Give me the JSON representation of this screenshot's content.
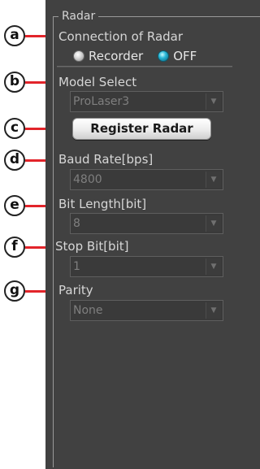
{
  "group": {
    "title": "Radar"
  },
  "connection": {
    "label": "Connection of Radar",
    "options": [
      {
        "label": "Recorder",
        "selected": false
      },
      {
        "label": "OFF",
        "selected": true
      }
    ]
  },
  "model": {
    "label": "Model Select",
    "value": "ProLaser3"
  },
  "register_button": {
    "label": "Register Radar"
  },
  "baud": {
    "label": "Baud Rate[bps]",
    "value": "4800"
  },
  "bit_length": {
    "label": "Bit Length[bit]",
    "value": "8"
  },
  "stop_bit": {
    "label": "Stop Bit[bit]",
    "value": "1"
  },
  "parity": {
    "label": "Parity",
    "value": "None"
  },
  "callouts": [
    "a",
    "b",
    "c",
    "d",
    "e",
    "f",
    "g"
  ],
  "colors": {
    "panel": "#414141",
    "leader": "#e2242a",
    "radio_selected": "#29b8d8"
  },
  "icons": {
    "dropdown": "chevron-down-icon",
    "radio": "radio-button-icon"
  }
}
